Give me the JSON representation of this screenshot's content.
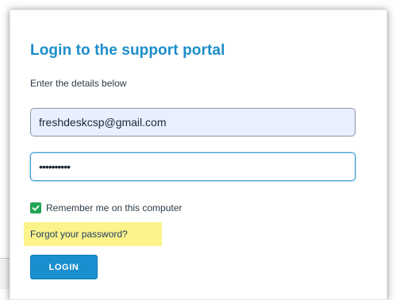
{
  "login": {
    "title": "Login to the support portal",
    "subtitle": "Enter the details below",
    "email_value": "freshdeskcsp@gmail.com",
    "password_value": "••••••••••",
    "remember_label": "Remember me on this computer",
    "remember_checked": true,
    "forgot_link": "Forgot your password?",
    "login_button": "LOGIN"
  },
  "icons": {
    "checkbox": "checkmark-icon"
  },
  "colors": {
    "title": "#1b8dc9",
    "button": "#1a8fd0",
    "checkbox": "#22a456",
    "highlight": "#fcf38a",
    "email_field_bg": "#e8f0fe",
    "password_field_border": "#3ea0d6"
  }
}
